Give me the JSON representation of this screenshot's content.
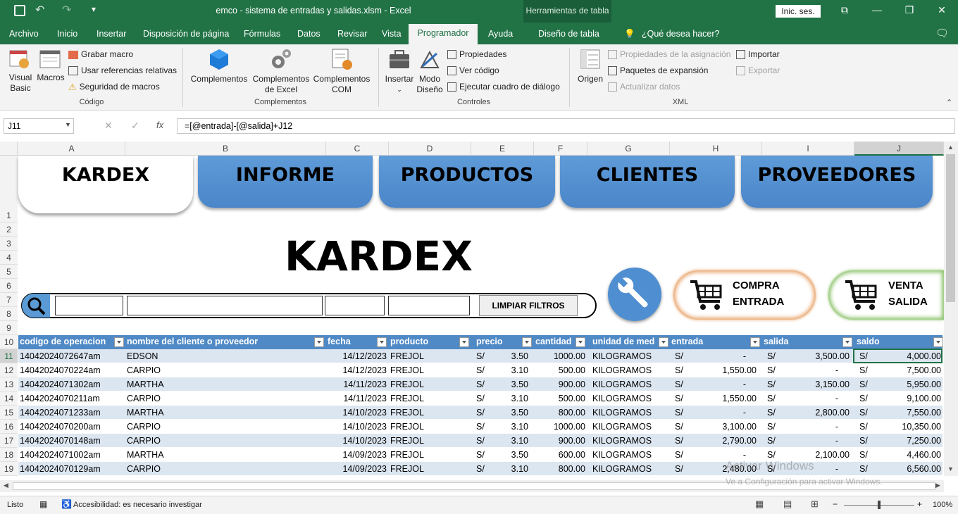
{
  "window": {
    "title": "emco - sistema de entradas y salidas.xlsm  -  Excel",
    "context_tab_group": "Herramientas de tabla",
    "signin": "Inic. ses."
  },
  "menu": {
    "tabs": [
      "Archivo",
      "Inicio",
      "Insertar",
      "Disposición de página",
      "Fórmulas",
      "Datos",
      "Revisar",
      "Vista",
      "Programador",
      "Ayuda",
      "Diseño de tabla"
    ],
    "active": "Programador",
    "tell_me": "¿Qué desea hacer?"
  },
  "ribbon": {
    "codigo": {
      "name": "Código",
      "visual_basic": "Visual Basic",
      "macros": "Macros",
      "grabar": "Grabar macro",
      "referencias": "Usar referencias relativas",
      "seguridad": "Seguridad de macros"
    },
    "complementos": {
      "name": "Complementos",
      "complementos": "Complementos",
      "excel": "Complementos de Excel",
      "com": "Complementos COM"
    },
    "controles": {
      "name": "Controles",
      "insertar": "Insertar",
      "modo": "Modo Diseño",
      "propiedades": "Propiedades",
      "ver_codigo": "Ver código",
      "ejecutar": "Ejecutar cuadro de diálogo"
    },
    "xml": {
      "name": "XML",
      "origen": "Origen",
      "prop_asignacion": "Propiedades de la asignación",
      "paquetes": "Paquetes de expansión",
      "actualizar": "Actualizar datos",
      "importar": "Importar",
      "exportar": "Exportar"
    }
  },
  "formula_bar": {
    "name_box": "J11",
    "formula": "=[@entrada]-[@salida]+J12"
  },
  "columns": [
    "A",
    "B",
    "C",
    "D",
    "E",
    "F",
    "G",
    "H",
    "I",
    "J"
  ],
  "rows": [
    "1",
    "2",
    "3",
    "4",
    "5",
    "6",
    "7",
    "8",
    "9",
    "10",
    "11",
    "12",
    "13",
    "14",
    "15",
    "16",
    "17",
    "18",
    "19"
  ],
  "sheet": {
    "nav_tabs": [
      "KARDEX",
      "INFORME",
      "PRODUCTOS",
      "CLIENTES",
      "PROVEEDORES"
    ],
    "active_tab": "KARDEX",
    "title": "KARDEX",
    "clear_filters": "LIMPIAR FILTROS",
    "compra_line1": "COMPRA",
    "compra_line2": "ENTRADA",
    "venta_line1": "VENTA",
    "venta_line2": "SALIDA"
  },
  "table": {
    "headers": [
      "codigo de operacion",
      "nombre del cliente o proveedor",
      "fecha",
      "producto",
      "precio",
      "cantidad",
      "unidad de med",
      "entrada",
      "salida",
      "saldo"
    ],
    "currency": "S/",
    "rows": [
      {
        "codigo": "14042024072647am",
        "nombre": "EDSON",
        "fecha": "14/12/2023",
        "producto": "FREJOL",
        "precio": "3.50",
        "cantidad": "1000.00",
        "unidad": "KILOGRAMOS",
        "entrada": "-",
        "salida": "3,500.00",
        "saldo": "4,000.00"
      },
      {
        "codigo": "14042024070224am",
        "nombre": "CARPIO",
        "fecha": "14/12/2023",
        "producto": "FREJOL",
        "precio": "3.10",
        "cantidad": "500.00",
        "unidad": "KILOGRAMOS",
        "entrada": "1,550.00",
        "salida": "-",
        "saldo": "7,500.00"
      },
      {
        "codigo": "14042024071302am",
        "nombre": "MARTHA",
        "fecha": "14/11/2023",
        "producto": "FREJOL",
        "precio": "3.50",
        "cantidad": "900.00",
        "unidad": "KILOGRAMOS",
        "entrada": "-",
        "salida": "3,150.00",
        "saldo": "5,950.00"
      },
      {
        "codigo": "14042024070211am",
        "nombre": "CARPIO",
        "fecha": "14/11/2023",
        "producto": "FREJOL",
        "precio": "3.10",
        "cantidad": "500.00",
        "unidad": "KILOGRAMOS",
        "entrada": "1,550.00",
        "salida": "-",
        "saldo": "9,100.00"
      },
      {
        "codigo": "14042024071233am",
        "nombre": "MARTHA",
        "fecha": "14/10/2023",
        "producto": "FREJOL",
        "precio": "3.50",
        "cantidad": "800.00",
        "unidad": "KILOGRAMOS",
        "entrada": "-",
        "salida": "2,800.00",
        "saldo": "7,550.00"
      },
      {
        "codigo": "14042024070200am",
        "nombre": "CARPIO",
        "fecha": "14/10/2023",
        "producto": "FREJOL",
        "precio": "3.10",
        "cantidad": "1000.00",
        "unidad": "KILOGRAMOS",
        "entrada": "3,100.00",
        "salida": "-",
        "saldo": "10,350.00"
      },
      {
        "codigo": "14042024070148am",
        "nombre": "CARPIO",
        "fecha": "14/10/2023",
        "producto": "FREJOL",
        "precio": "3.10",
        "cantidad": "900.00",
        "unidad": "KILOGRAMOS",
        "entrada": "2,790.00",
        "salida": "-",
        "saldo": "7,250.00"
      },
      {
        "codigo": "14042024071002am",
        "nombre": "MARTHA",
        "fecha": "14/09/2023",
        "producto": "FREJOL",
        "precio": "3.50",
        "cantidad": "600.00",
        "unidad": "KILOGRAMOS",
        "entrada": "-",
        "salida": "2,100.00",
        "saldo": "4,460.00"
      },
      {
        "codigo": "14042024070129am",
        "nombre": "CARPIO",
        "fecha": "14/09/2023",
        "producto": "FREJOL",
        "precio": "3.10",
        "cantidad": "800.00",
        "unidad": "KILOGRAMOS",
        "entrada": "2,480.00",
        "salida": "-",
        "saldo": "6,560.00"
      }
    ]
  },
  "status": {
    "ready": "Listo",
    "accessibility": "Accesibilidad: es necesario investigar",
    "zoom": "100%"
  },
  "watermark": {
    "line1": "Activar Windows",
    "line2": "Ve a Configuración para activar Windows."
  },
  "colors": {
    "excel_green": "#217346",
    "table_header": "#4f89c6",
    "band": "#dce6f1",
    "tab_blue": "#5b9bd5"
  }
}
